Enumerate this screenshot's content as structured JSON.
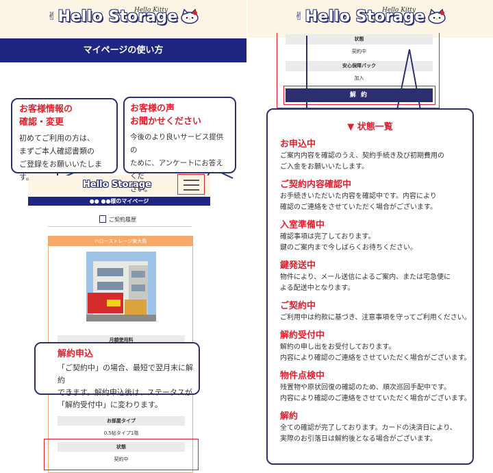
{
  "brand": {
    "logo_text": "Hello Storage",
    "logo_small": "Hello Kitty"
  },
  "left": {
    "title_bar": "マイページの使い方",
    "bubble_info": {
      "title_line1": "お客様情報の",
      "title_line2": "確認・変更",
      "body": [
        "初めてご利用の方は、",
        "まずご本人確認書類の",
        "ご登録をお願いいたします。"
      ]
    },
    "bubble_voice": {
      "title_line1": "お客様の声",
      "title_line2": "お聞かせください",
      "body": [
        "今後のより良いサービス提供の",
        "ために、アンケートにお答えくだ",
        "さい。"
      ]
    },
    "mini": {
      "logo_text": "Hello Storage",
      "mypage_bar": "●● ●●様のマイページ",
      "contract_link": "ご契約履歴",
      "card_title": "ハローストレージ東大島",
      "monthly_fee_label": "月額使用料",
      "room_type_label": "お部屋タイプ",
      "room_type_value": "0.5帖タイプ1階",
      "status_label": "状態",
      "status_value": "契約中"
    },
    "bubble_cancel": {
      "title": "解約申込",
      "body": [
        "「ご契約中」の場合、最短で翌月末に解約",
        "できます。解約申込後は、ステータスが",
        "「解約受付中」に変わります。"
      ]
    }
  },
  "right": {
    "rows": {
      "status_label": "状態",
      "status_value": "契約中",
      "insurance_label": "安心保障パック",
      "insurance_value": "加入"
    },
    "cancel_button": "解 約",
    "status_list": {
      "heading": "▼ 状態一覧",
      "items": [
        {
          "name": "お申込中",
          "desc": "ご案内内容を確認のうえ、契約手続き及び初期費用の\nご入金をお願いいたします。"
        },
        {
          "name": "ご契約内容確認中",
          "desc": "お手続きいただいた内容を確認中です。内容により\n確認のご連絡をさせていただく場合がございます。"
        },
        {
          "name": "入室準備中",
          "desc": "確認事項は完了しております。\n鍵のご案内まで今しばらくお待ちください。"
        },
        {
          "name": "鍵発送中",
          "desc": "物件により、メール送信によるご案内、または宅急便に\nよる配送中となります。"
        },
        {
          "name": "ご契約中",
          "desc": "ご利用中は約款に基づき、注意事項を守ってご利用ください。"
        },
        {
          "name": "解約受付中",
          "desc": "解約の申し出をお受付しております。\n内容により確認のご連絡をさせていただく場合がございます。"
        },
        {
          "name": "物件点検中",
          "desc": "残置物や原状回復の確認のため、順次巡回手配中です。\n内容により確認のご連絡をさせていただく場合がございます。"
        },
        {
          "name": "解約",
          "desc": "全ての確認が完了しております。カードの決済日により、\n実際のお引落日は解約後となる場合がございます。"
        }
      ]
    }
  }
}
